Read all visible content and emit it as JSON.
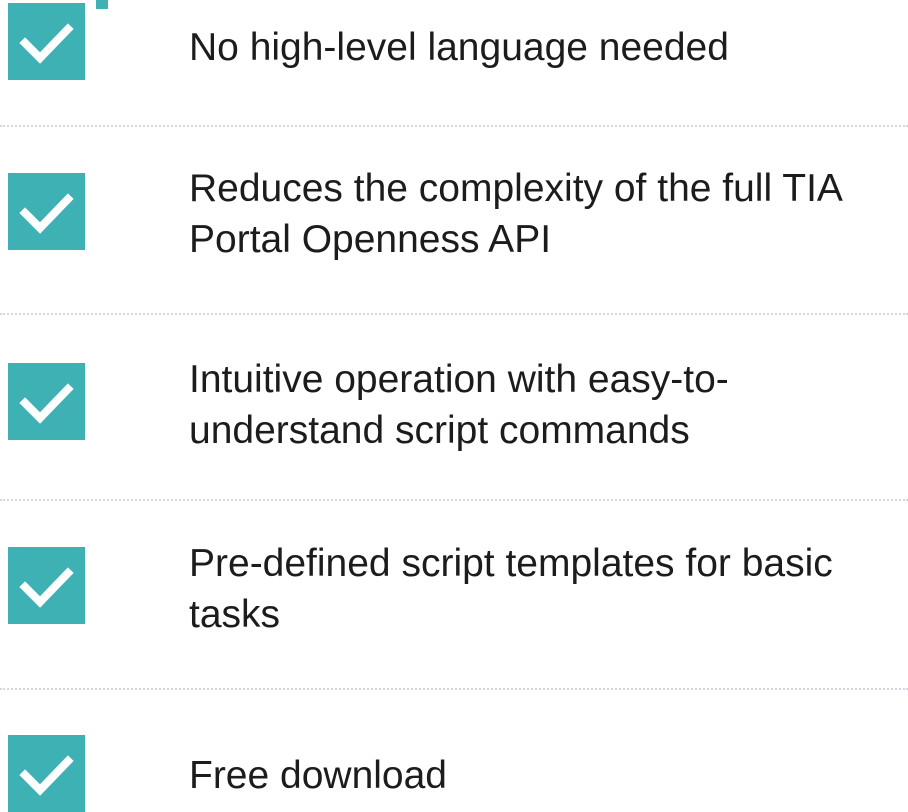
{
  "theme": {
    "accent_color": "#3eb1b4",
    "check_icon": "checkmark-icon"
  },
  "features": [
    {
      "label": "No high-level language needed"
    },
    {
      "label": "Reduces the complexity of the full TIA\nPortal Openness API"
    },
    {
      "label": "Intuitive operation with easy-to-\nunderstand script commands"
    },
    {
      "label": "Pre-defined script templates for basic\ntasks"
    },
    {
      "label": "Free download"
    }
  ]
}
